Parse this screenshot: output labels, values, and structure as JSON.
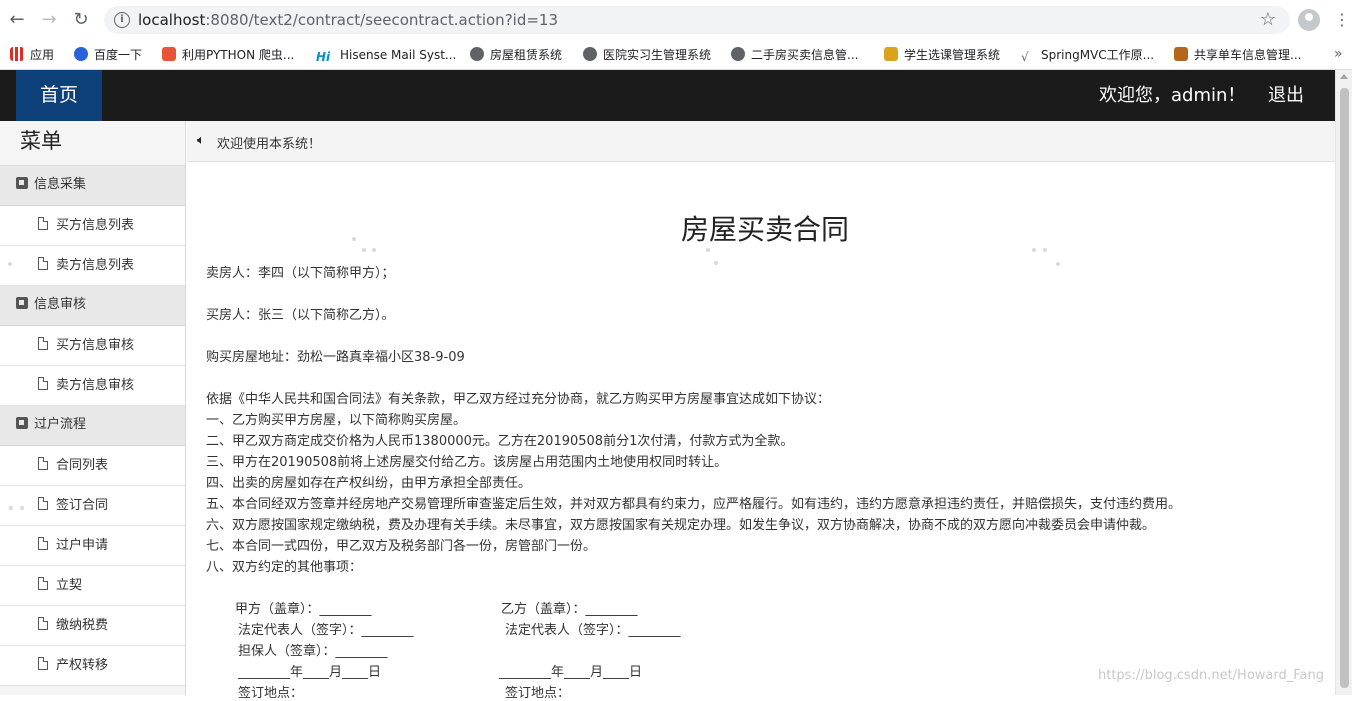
{
  "browser": {
    "url_host": "localhost",
    "url_rest": ":8080/text2/contract/seecontract.action?id=13",
    "bookmarks": [
      {
        "label": "应用",
        "color": "#d93025"
      },
      {
        "label": "百度一下",
        "color": "#2a62d9"
      },
      {
        "label": "利用PYTHON 爬虫...",
        "color": "#e8543a"
      },
      {
        "label": "Hisense Mail Syst...",
        "color": "#0a8fc9"
      },
      {
        "label": "房屋租赁系统",
        "color": "#5f6368"
      },
      {
        "label": "医院实习生管理系统",
        "color": "#5f6368"
      },
      {
        "label": "二手房买卖信息管...",
        "color": "#5f6368"
      },
      {
        "label": "学生选课管理系统",
        "color": "#d9a41c"
      },
      {
        "label": "SpringMVC工作原...",
        "color": "#5f6368"
      },
      {
        "label": "共享单车信息管理...",
        "color": "#b5651d"
      }
    ]
  },
  "header": {
    "home": "首页",
    "welcome": "欢迎您，admin！",
    "logout": "退出"
  },
  "sidebar": {
    "title": "菜单",
    "groups": [
      {
        "label": "信息采集",
        "items": [
          "买方信息列表",
          "卖方信息列表"
        ]
      },
      {
        "label": "信息审核",
        "items": [
          "买方信息审核",
          "卖方信息审核"
        ]
      },
      {
        "label": "过户流程",
        "items": [
          "合同列表",
          "签订合同",
          "过户申请",
          "立契",
          "缴纳税费",
          "产权转移"
        ]
      }
    ]
  },
  "notice": "欢迎使用本系统！",
  "contract": {
    "title": "房屋买卖合同",
    "seller": "卖房人：李四（以下简称甲方）；",
    "buyer": "买房人：张三（以下简称乙方）。",
    "address": "购买房屋地址：劲松一路真幸福小区38-9-09",
    "clauses": [
      "依据《中华人民共和国合同法》有关条款，甲乙双方经过充分协商，就乙方购买甲方房屋事宜达成如下协议：",
      "一、乙方购买甲方房屋，以下简称购买房屋。",
      "二、甲乙双方商定成交价格为人民币1380000元。乙方在20190508前分1次付清，付款方式为全款。",
      "三、甲方在20190508前将上述房屋交付给乙方。该房屋占用范围内土地使用权同时转让。",
      "四、出卖的房屋如存在产权纠纷，由甲方承担全部责任。",
      "五、本合同经双方签章并经房地产交易管理所审查鉴定后生效，并对双方都具有约束力，应严格履行。如有违约，违约方愿意承担违约责任，并赔偿损失，支付违约费用。",
      "六、双方愿按国家规定缴纳税，费及办理有关手续。未尽事宜，双方愿按国家有关规定办理。如发生争议，双方协商解决，协商不成的双方愿向冲裁委员会申请仲裁。",
      "七、本合同一式四份，甲乙双方及税务部门各一份，房管部门一份。",
      "八、双方约定的其他事项："
    ],
    "party_a": {
      "seal": "甲方（盖章）：________",
      "rep": "法定代表人（签字）：________",
      "guarantor": "担保人（签章）：________",
      "date": "________年____月____日",
      "place": "签订地点："
    },
    "party_b": {
      "seal": "乙方（盖章）：________",
      "rep": "法定代表人（签字）：________",
      "date": "________年____月____日",
      "place": "签订地点："
    }
  },
  "watermark": "https://blog.csdn.net/Howard_Fang"
}
